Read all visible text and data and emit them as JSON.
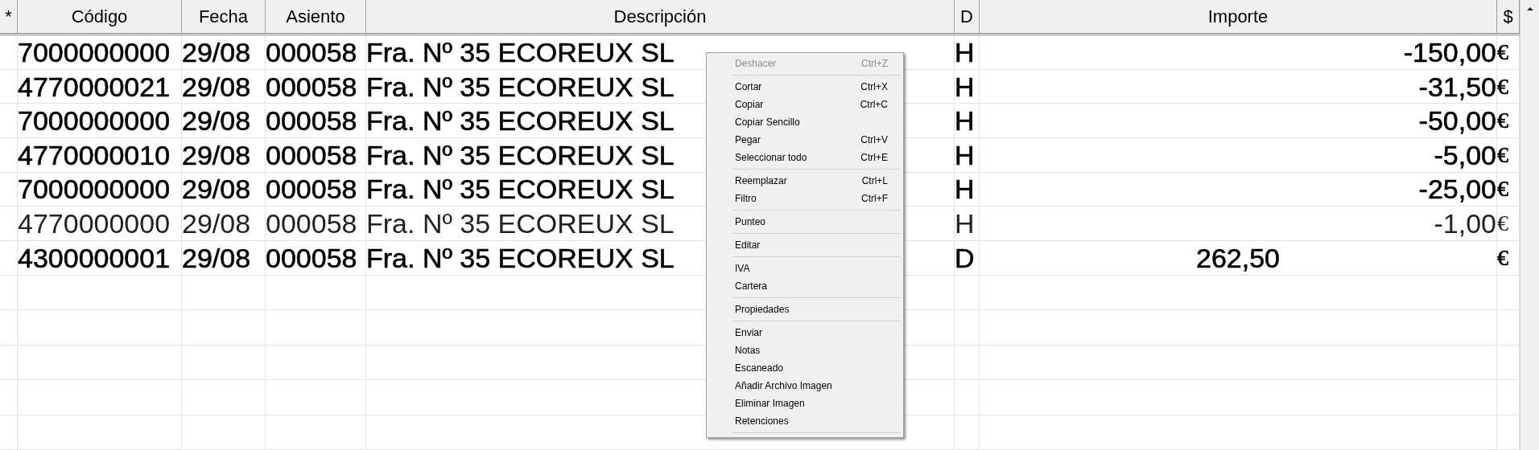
{
  "table": {
    "columns": [
      "*",
      "Código",
      "Fecha",
      "Asiento",
      "Descripción",
      "D",
      "Importe",
      "$"
    ],
    "rows": [
      {
        "cells": [
          "",
          "7000000000",
          "29/08",
          "000058",
          "Fra. Nº 35 ECOREUX SL",
          "H",
          "-150,00",
          "€"
        ],
        "bold": true,
        "amount_centered": false
      },
      {
        "cells": [
          "",
          "4770000021",
          "29/08",
          "000058",
          "Fra. Nº 35 ECOREUX SL",
          "H",
          "-31,50",
          "€"
        ],
        "bold": true,
        "amount_centered": false
      },
      {
        "cells": [
          "",
          "7000000000",
          "29/08",
          "000058",
          "Fra. Nº 35 ECOREUX SL",
          "H",
          "-50,00",
          "€"
        ],
        "bold": true,
        "amount_centered": false
      },
      {
        "cells": [
          "",
          "4770000010",
          "29/08",
          "000058",
          "Fra. Nº 35 ECOREUX SL",
          "H",
          "-5,00",
          "€"
        ],
        "bold": true,
        "amount_centered": false
      },
      {
        "cells": [
          "",
          "7000000000",
          "29/08",
          "000058",
          "Fra. Nº 35 ECOREUX SL",
          "H",
          "-25,00",
          "€"
        ],
        "bold": true,
        "amount_centered": false
      },
      {
        "cells": [
          "",
          "4770000000",
          "29/08",
          "000058",
          "Fra. Nº 35 ECOREUX SL",
          "H",
          "-1,00",
          "€"
        ],
        "bold": false,
        "amount_centered": false
      },
      {
        "cells": [
          "",
          "4300000001",
          "29/08",
          "000058",
          "Fra. Nº 35 ECOREUX SL",
          "D",
          "262,50",
          "€"
        ],
        "bold": true,
        "amount_centered": true
      }
    ]
  },
  "context_menu": {
    "items": [
      {
        "kind": "item",
        "label": "Deshacer",
        "shortcut": "Ctrl+Z",
        "disabled": true
      },
      {
        "kind": "separator"
      },
      {
        "kind": "item",
        "label": "Cortar",
        "shortcut": "Ctrl+X",
        "disabled": false
      },
      {
        "kind": "item",
        "label": "Copiar",
        "shortcut": "Ctrl+C",
        "disabled": false
      },
      {
        "kind": "item",
        "label": "Copiar Sencillo",
        "disabled": false
      },
      {
        "kind": "item",
        "label": "Pegar",
        "shortcut": "Ctrl+V",
        "disabled": false
      },
      {
        "kind": "item",
        "label": "Seleccionar todo",
        "shortcut": "Ctrl+E",
        "disabled": false
      },
      {
        "kind": "separator"
      },
      {
        "kind": "item",
        "label": "Reemplazar",
        "shortcut": "Ctrl+L",
        "disabled": false
      },
      {
        "kind": "item",
        "label": "Filtro",
        "shortcut": "Ctrl+F",
        "disabled": false
      },
      {
        "kind": "separator"
      },
      {
        "kind": "item",
        "label": "Punteo",
        "disabled": false
      },
      {
        "kind": "separator"
      },
      {
        "kind": "item",
        "label": "Editar",
        "disabled": false
      },
      {
        "kind": "separator"
      },
      {
        "kind": "item",
        "label": "IVA",
        "disabled": false
      },
      {
        "kind": "item",
        "label": "Cartera",
        "disabled": false
      },
      {
        "kind": "separator"
      },
      {
        "kind": "item",
        "label": "Propiedades",
        "disabled": false
      },
      {
        "kind": "separator"
      },
      {
        "kind": "item",
        "label": "Enviar",
        "disabled": false
      },
      {
        "kind": "item",
        "label": "Notas",
        "disabled": false
      },
      {
        "kind": "item",
        "label": "Escaneado",
        "disabled": false
      },
      {
        "kind": "item",
        "label": "Añadir Archivo Imagen",
        "disabled": false
      },
      {
        "kind": "item",
        "label": "Eliminar Imagen",
        "disabled": false
      },
      {
        "kind": "item",
        "label": "Retenciones",
        "disabled": false
      },
      {
        "kind": "separator"
      }
    ]
  }
}
